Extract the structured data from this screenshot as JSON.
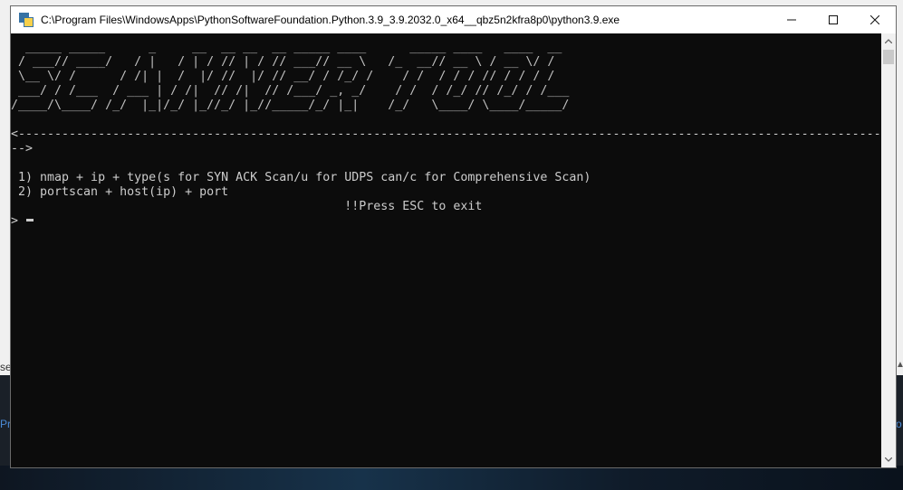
{
  "background": {
    "left_text_1": "se",
    "left_text_2": "Pri",
    "right_text_2": "o"
  },
  "window": {
    "title": "C:\\Program Files\\WindowsApps\\PythonSoftwareFoundation.Python.3.9_3.9.2032.0_x64__qbz5n2kfra8p0\\python3.9.exe",
    "icon": "python-icon",
    "controls": [
      "minimize-icon",
      "maximize-icon",
      "close-icon"
    ]
  },
  "console": {
    "banner": [
      "  _____ _____      _     __  __ __  __ _____ ____      _____ ____   ____  __",
      " / ___// ____/   / |   / | / // | / // ___// __ \\   /_  __// __ \\ / __ \\/ /",
      " \\__ \\/ /      / /| |  /  |/ //  |/ // __/ / /_/ /    / /  / / / // / / / /",
      " ___/ / /___  / ___ | / /|  // /|  // /___/ _, _/    / /  / /_/ // /_/ / /___",
      "/____/\\____/ /_/  |_|/_/ |_//_/ |_//_____/_/ |_|    /_/   \\____/ \\____/_____/"
    ],
    "separator_1": "<------------------------------------------------------------------------------------------------------------------------",
    "separator_2": "-->",
    "options": [
      " 1) nmap + ip + type(s for SYN ACK Scan/u for UDPS can/c for Comprehensive Scan)",
      " 2) portscan + host(ip) + port"
    ],
    "exit_hint": "                                              !!Press ESC to exit",
    "prompt": "> "
  },
  "colors": {
    "console_bg": "#0c0c0c",
    "console_text": "#cccccc",
    "titlebar_bg": "#ffffff"
  }
}
